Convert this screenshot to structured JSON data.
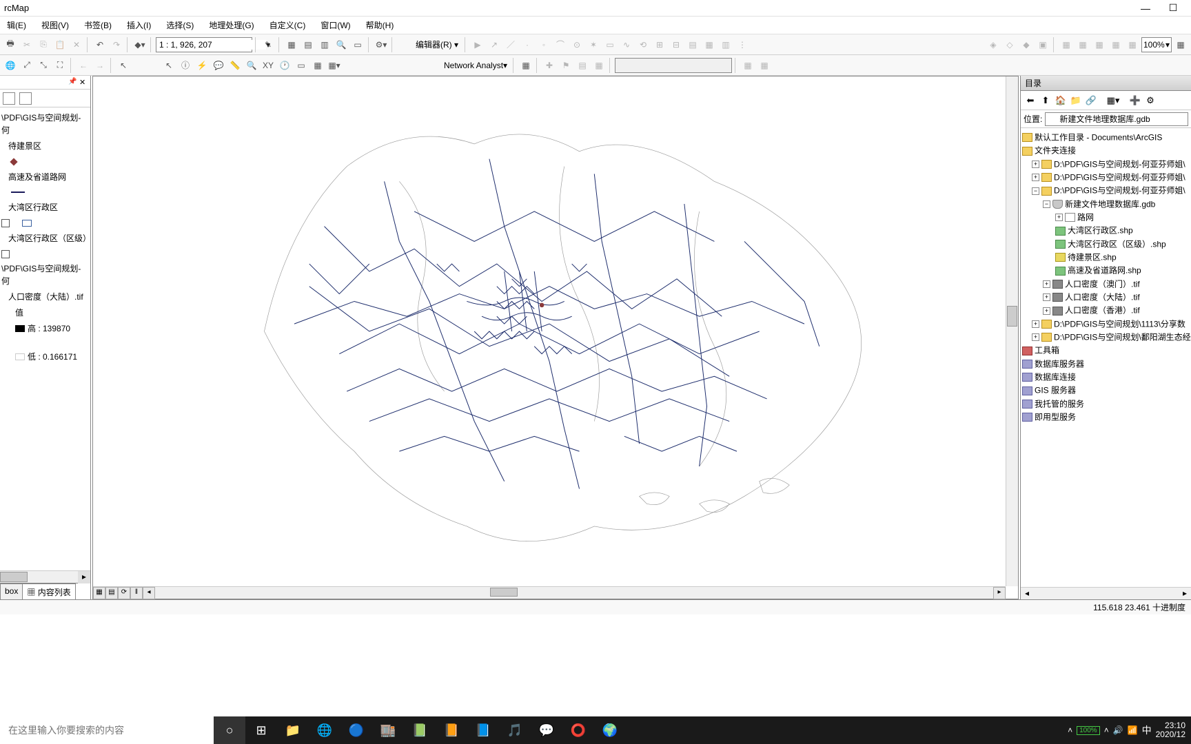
{
  "window": {
    "title": "rcMap"
  },
  "menu": {
    "edit": "辑(E)",
    "view": "视图(V)",
    "bookmarks": "书签(B)",
    "insert": "插入(I)",
    "select": "选择(S)",
    "geoproc": "地理处理(G)",
    "custom": "自定义(C)",
    "window": "窗口(W)",
    "help": "帮助(H)"
  },
  "toolbar1": {
    "scale": "1 : 1, 926, 207",
    "editor": "编辑器(R)",
    "zoom": "100%"
  },
  "toolbar2": {
    "na": "Network Analyst"
  },
  "toc": {
    "tab_box": "box",
    "tab_content": "内容列表",
    "items": [
      {
        "name": "\\PDF\\GIS与空间规划-何",
        "sub": "待建景区",
        "sym": "dot"
      },
      {
        "name": "高速及省道路网",
        "sym": "line"
      },
      {
        "name": "大湾区行政区",
        "sym": "box",
        "checked": false
      },
      {
        "name": "大湾区行政区（区级）",
        "checked": false
      },
      {
        "name": "\\PDF\\GIS与空间规划-何",
        "sub": "人口密度（大陆）.tif"
      }
    ],
    "legend": {
      "label": "值",
      "high": "高 : 139870",
      "low": "低 : 0.166171"
    }
  },
  "catalog": {
    "title": "目录",
    "location_label": "位置:",
    "location_value": "新建文件地理数据库.gdb",
    "tree": {
      "default_ws": "默认工作目录 - Documents\\ArcGIS",
      "folder_conn": "文件夹连接",
      "folders": [
        "D:\\PDF\\GIS与空间规划-何亚芬师姐\\",
        "D:\\PDF\\GIS与空间规划-何亚芬师姐\\",
        "D:\\PDF\\GIS与空间规划-何亚芬师姐\\"
      ],
      "gdb": "新建文件地理数据库.gdb",
      "gdb_items": [
        "路网",
        "大湾区行政区.shp",
        "大湾区行政区（区级）.shp",
        "待建景区.shp",
        "高速及省道路网.shp",
        "人口密度（澳门）.tif",
        "人口密度（大陆）.tif",
        "人口密度（香港）.tif"
      ],
      "more_folders": [
        "D:\\PDF\\GIS与空间规划\\1113\\分享数",
        "D:\\PDF\\GIS与空间规划\\鄱阳湖生态经"
      ],
      "nodes": [
        "工具箱",
        "数据库服务器",
        "数据库连接",
        "GIS 服务器",
        "我托管的服务",
        "即用型服务"
      ]
    }
  },
  "status": {
    "coords": "115.618  23.461 十进制度"
  },
  "taskbar": {
    "search_ph": "在这里输入你要搜索的内容",
    "battery": "100%",
    "ime": "中",
    "time": "23:10",
    "date": "2020/12"
  }
}
